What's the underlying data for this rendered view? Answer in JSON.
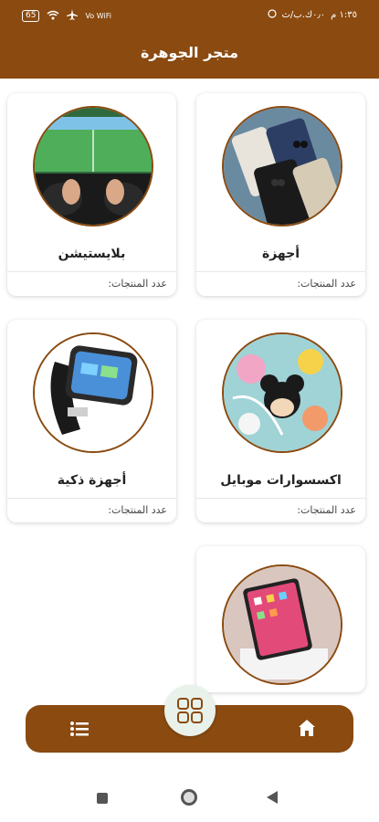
{
  "status": {
    "time": "١:٣٥ م",
    "info": "٠٫٠ك.ب/ث",
    "battery": "65",
    "network": "Vo WiFi"
  },
  "app": {
    "title": "متجر الجوهرة"
  },
  "cards": [
    {
      "name": "أجهزة",
      "count_label": "عدد المنتجات:",
      "icon": "phones-image"
    },
    {
      "name": "بلايستيشن",
      "count_label": "عدد المنتجات:",
      "icon": "playstation-image"
    },
    {
      "name": "اكسسوارات موبايل",
      "count_label": "عدد المنتجات:",
      "icon": "mobile-accessories-image"
    },
    {
      "name": "أجهزة ذكية",
      "count_label": "عدد المنتجات:",
      "icon": "smartwatch-image"
    },
    {
      "name": "",
      "count_label": "",
      "icon": "tablet-image"
    }
  ],
  "nav": {
    "home": "home-icon",
    "center": "grid-icon",
    "list": "list-icon"
  },
  "colors": {
    "primary": "#8a4a10",
    "center_bg": "#e9f2ea"
  }
}
